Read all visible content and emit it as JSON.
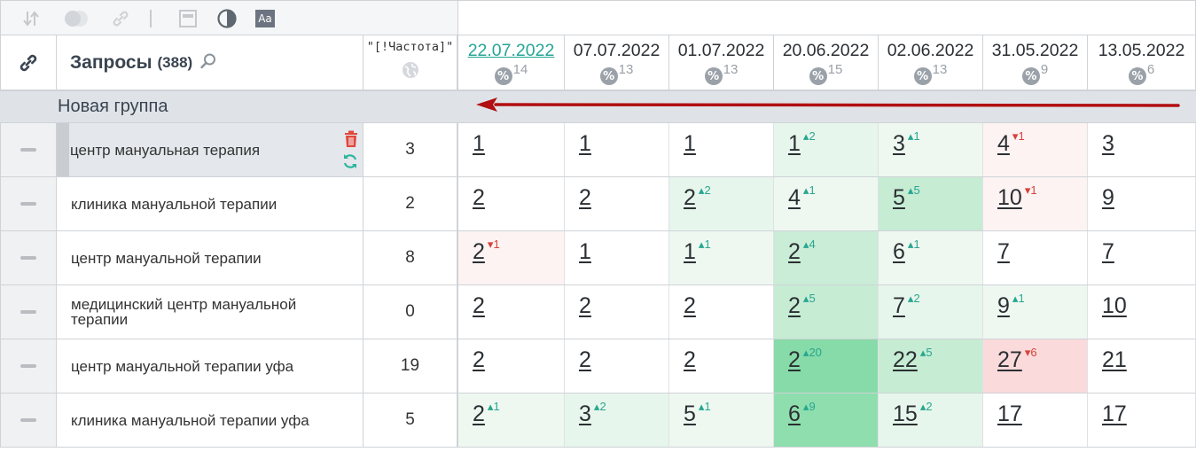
{
  "toolbar": {
    "icons": [
      "sort-icon",
      "toggle-icon",
      "link-icon",
      "separator",
      "window-icon",
      "contrast-icon",
      "font-icon"
    ],
    "font_icon_text": "Aa"
  },
  "header": {
    "query_title": "Запросы",
    "query_count": "(388)",
    "freq_label": "\"[!Частота]\"",
    "dates": [
      {
        "date": "22.07.2022",
        "pct": "%",
        "num": "14",
        "active": true
      },
      {
        "date": "07.07.2022",
        "pct": "%",
        "num": "13",
        "active": false
      },
      {
        "date": "01.07.2022",
        "pct": "%",
        "num": "13",
        "active": false
      },
      {
        "date": "20.06.2022",
        "pct": "%",
        "num": "15",
        "active": false
      },
      {
        "date": "02.06.2022",
        "pct": "%",
        "num": "13",
        "active": false
      },
      {
        "date": "31.05.2022",
        "pct": "%",
        "num": "9",
        "active": false
      },
      {
        "date": "13.05.2022",
        "pct": "%",
        "num": "6",
        "active": false
      }
    ]
  },
  "group": {
    "name": "Новая группа"
  },
  "colors": {
    "accent": "#25a596",
    "arrow": "#b10f12",
    "up": "#28a690",
    "down": "#d6423a"
  },
  "rows": [
    {
      "query": "центр мануальная терапия",
      "freq": "3",
      "selected": true,
      "cells": [
        {
          "v": "1",
          "d": "",
          "dir": "",
          "bg": "#ffffff"
        },
        {
          "v": "1",
          "d": "",
          "dir": "",
          "bg": "#ffffff"
        },
        {
          "v": "1",
          "d": "",
          "dir": "",
          "bg": "#ffffff"
        },
        {
          "v": "1",
          "d": "2",
          "dir": "up",
          "bg": "#e7f6ec"
        },
        {
          "v": "3",
          "d": "1",
          "dir": "up",
          "bg": "#eef8f1"
        },
        {
          "v": "4",
          "d": "1",
          "dir": "down",
          "bg": "#fdf3f3"
        },
        {
          "v": "3",
          "d": "",
          "dir": "",
          "bg": "#ffffff"
        }
      ]
    },
    {
      "query": "клиника мануальной терапии",
      "freq": "2",
      "selected": false,
      "cells": [
        {
          "v": "2",
          "d": "",
          "dir": "",
          "bg": "#ffffff"
        },
        {
          "v": "2",
          "d": "",
          "dir": "",
          "bg": "#ffffff"
        },
        {
          "v": "2",
          "d": "2",
          "dir": "up",
          "bg": "#e7f6ec"
        },
        {
          "v": "4",
          "d": "1",
          "dir": "up",
          "bg": "#eef8f1"
        },
        {
          "v": "5",
          "d": "5",
          "dir": "up",
          "bg": "#c6ecd4"
        },
        {
          "v": "10",
          "d": "1",
          "dir": "down",
          "bg": "#fdf3f3"
        },
        {
          "v": "9",
          "d": "",
          "dir": "",
          "bg": "#ffffff"
        }
      ]
    },
    {
      "query": "центр мануальной терапии",
      "freq": "8",
      "selected": false,
      "cells": [
        {
          "v": "2",
          "d": "1",
          "dir": "down",
          "bg": "#fdf3f3"
        },
        {
          "v": "1",
          "d": "",
          "dir": "",
          "bg": "#ffffff"
        },
        {
          "v": "1",
          "d": "1",
          "dir": "up",
          "bg": "#eef8f1"
        },
        {
          "v": "2",
          "d": "4",
          "dir": "up",
          "bg": "#c9edd6"
        },
        {
          "v": "6",
          "d": "1",
          "dir": "up",
          "bg": "#eef8f1"
        },
        {
          "v": "7",
          "d": "",
          "dir": "",
          "bg": "#ffffff"
        },
        {
          "v": "7",
          "d": "",
          "dir": "",
          "bg": "#ffffff"
        }
      ]
    },
    {
      "query": "медицинский центр мануальной терапии",
      "freq": "0",
      "selected": false,
      "cells": [
        {
          "v": "2",
          "d": "",
          "dir": "",
          "bg": "#ffffff"
        },
        {
          "v": "2",
          "d": "",
          "dir": "",
          "bg": "#ffffff"
        },
        {
          "v": "2",
          "d": "",
          "dir": "",
          "bg": "#ffffff"
        },
        {
          "v": "2",
          "d": "5",
          "dir": "up",
          "bg": "#c6ecd4"
        },
        {
          "v": "7",
          "d": "2",
          "dir": "up",
          "bg": "#e7f6ec"
        },
        {
          "v": "9",
          "d": "1",
          "dir": "up",
          "bg": "#eef8f1"
        },
        {
          "v": "10",
          "d": "",
          "dir": "",
          "bg": "#ffffff"
        }
      ]
    },
    {
      "query": "центр мануальной терапии уфа",
      "freq": "19",
      "selected": false,
      "cells": [
        {
          "v": "2",
          "d": "",
          "dir": "",
          "bg": "#ffffff"
        },
        {
          "v": "2",
          "d": "",
          "dir": "",
          "bg": "#ffffff"
        },
        {
          "v": "2",
          "d": "",
          "dir": "",
          "bg": "#ffffff"
        },
        {
          "v": "2",
          "d": "20",
          "dir": "up",
          "bg": "#86dba8"
        },
        {
          "v": "22",
          "d": "5",
          "dir": "up",
          "bg": "#c6ecd4"
        },
        {
          "v": "27",
          "d": "6",
          "dir": "down",
          "bg": "#fbdadb"
        },
        {
          "v": "21",
          "d": "",
          "dir": "",
          "bg": "#ffffff"
        }
      ]
    },
    {
      "query": "клиника мануальной терапии уфа",
      "freq": "5",
      "selected": false,
      "cells": [
        {
          "v": "2",
          "d": "1",
          "dir": "up",
          "bg": "#eef8f1"
        },
        {
          "v": "3",
          "d": "2",
          "dir": "up",
          "bg": "#e7f6ec"
        },
        {
          "v": "5",
          "d": "1",
          "dir": "up",
          "bg": "#eef8f1"
        },
        {
          "v": "6",
          "d": "9",
          "dir": "up",
          "bg": "#8fdeae"
        },
        {
          "v": "15",
          "d": "2",
          "dir": "up",
          "bg": "#e7f6ec"
        },
        {
          "v": "17",
          "d": "",
          "dir": "",
          "bg": "#ffffff"
        },
        {
          "v": "17",
          "d": "",
          "dir": "",
          "bg": "#ffffff"
        }
      ]
    }
  ]
}
